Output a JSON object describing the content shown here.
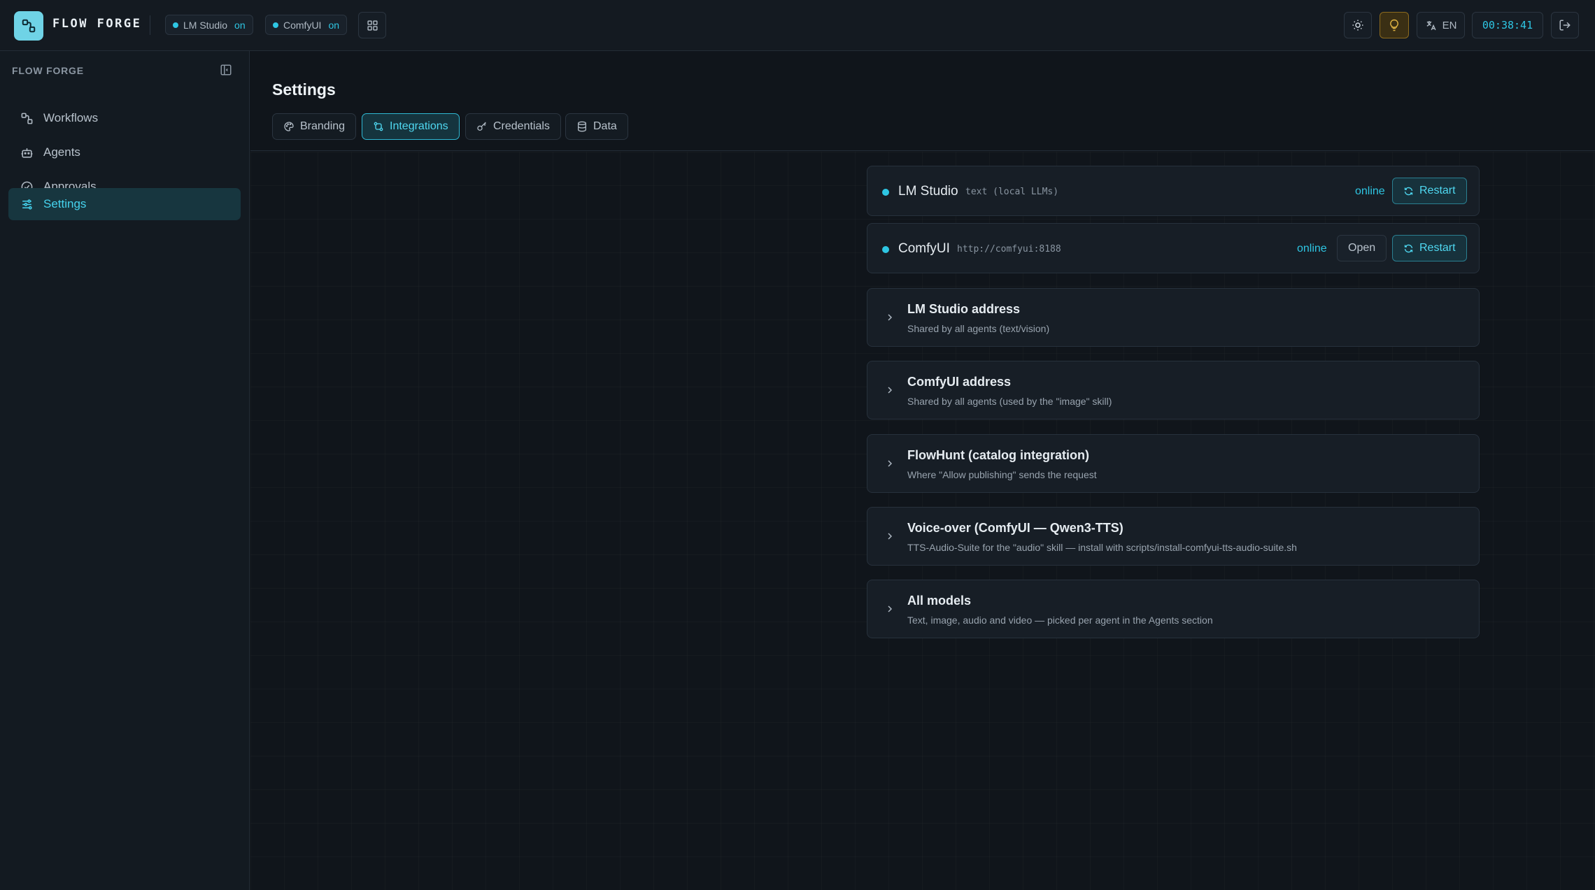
{
  "app": {
    "brand": "FLOW FORGE",
    "services": [
      {
        "name": "LM Studio",
        "state": "on"
      },
      {
        "name": "ComfyUI",
        "state": "on"
      }
    ],
    "language": "EN",
    "clock": "00:38:41"
  },
  "sidebar": {
    "title": "FLOW FORGE",
    "items": [
      {
        "label": "Workflows",
        "icon": "workflow-icon"
      },
      {
        "label": "Agents",
        "icon": "bot-icon"
      },
      {
        "label": "Approvals",
        "icon": "check-circle-icon"
      },
      {
        "label": "Settings",
        "icon": "sliders-icon",
        "active": true
      }
    ]
  },
  "page": {
    "title": "Settings",
    "tabs": [
      {
        "label": "Branding",
        "icon": "palette-icon"
      },
      {
        "label": "Integrations",
        "icon": "integrations-icon",
        "active": true
      },
      {
        "label": "Credentials",
        "icon": "key-icon"
      },
      {
        "label": "Data",
        "icon": "database-icon"
      }
    ]
  },
  "services": [
    {
      "name": "LM Studio",
      "description": "text (local LLMs)",
      "status": "online",
      "restart_label": "Restart"
    },
    {
      "name": "ComfyUI",
      "description": "http://comfyui:8188",
      "status": "online",
      "open_label": "Open",
      "restart_label": "Restart"
    }
  ],
  "sections": [
    {
      "title": "LM Studio address",
      "subtitle": "Shared by all agents (text/vision)"
    },
    {
      "title": "ComfyUI address",
      "subtitle": "Shared by all agents (used by the \"image\" skill)"
    },
    {
      "title": "FlowHunt (catalog integration)",
      "subtitle": "Where \"Allow publishing\" sends the request"
    },
    {
      "title": "Voice-over (ComfyUI — Qwen3-TTS)",
      "subtitle": "TTS-Audio-Suite for the \"audio\" skill — install with scripts/install-comfyui-tts-audio-suite.sh"
    },
    {
      "title": "All models",
      "subtitle": "Text, image, audio and video — picked per agent in the Agents section"
    }
  ],
  "colors": {
    "accent": "#2ec6e3",
    "background": "#10151b",
    "amber": "#e0b442"
  }
}
